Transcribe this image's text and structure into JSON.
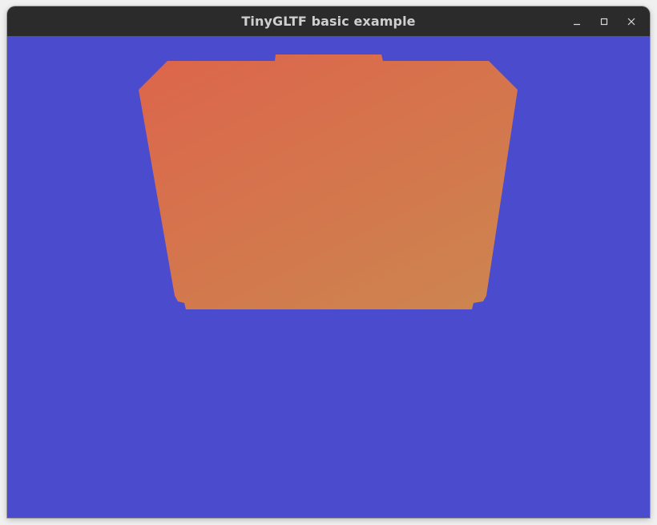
{
  "window": {
    "title": "TinyGLTF basic example",
    "controls": [
      "minimize-icon",
      "maximize-icon",
      "close-icon"
    ]
  },
  "scene": {
    "clear_color": "#4b4bce",
    "model_gradient_start": "#dc664b",
    "model_gradient_end": "#cd844f"
  }
}
